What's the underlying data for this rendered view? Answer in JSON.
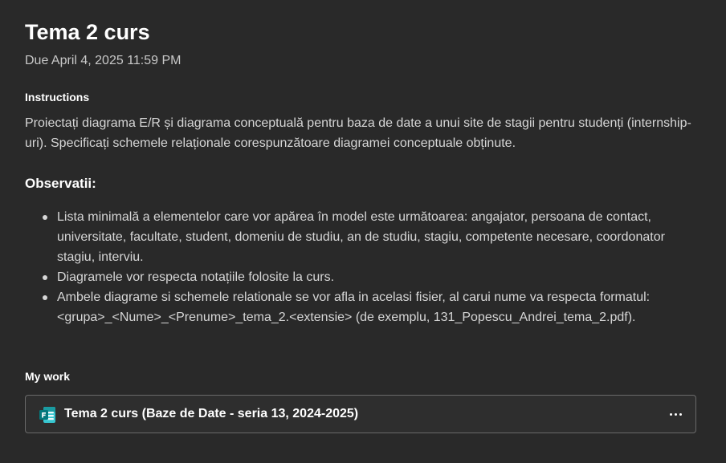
{
  "assignment": {
    "title": "Tema 2 curs",
    "due": "Due April 4, 2025 11:59 PM"
  },
  "instructions": {
    "label": "Instructions",
    "text": "Proiectați diagrama E/R și diagrama conceptuală pentru baza de date a unui site de stagii pentru studenți (internship-uri). Specificați schemele relaționale corespunzătoare diagramei conceptuale obținute.",
    "observations_heading": "Observatii:",
    "observations": [
      "Lista minimală a elementelor care vor apărea în model este următoarea: angajator, persoana de contact, universitate, facultate, student, domeniu de studiu, an de studiu, stagiu, competente necesare, coordonator stagiu, interviu.",
      "Diagramele vor respecta notațiile folosite la curs.",
      "Ambele diagrame si schemele relationale se vor afla in acelasi fisier, al carui nume va respecta formatul: <grupa>_<Nume>_<Prenume>_tema_2.<extensie> (de exemplu, 131_Popescu_Andrei_tema_2.pdf)."
    ]
  },
  "my_work": {
    "label": "My work",
    "item": {
      "icon": "microsoft-forms-icon",
      "title": "Tema 2 curs (Baze de Date - seria 13, 2024-2025)",
      "more_icon": "more-options-icon"
    }
  },
  "colors": {
    "background": "#292929",
    "card_border": "#6a6a6a",
    "forms_green": "#03787c"
  }
}
